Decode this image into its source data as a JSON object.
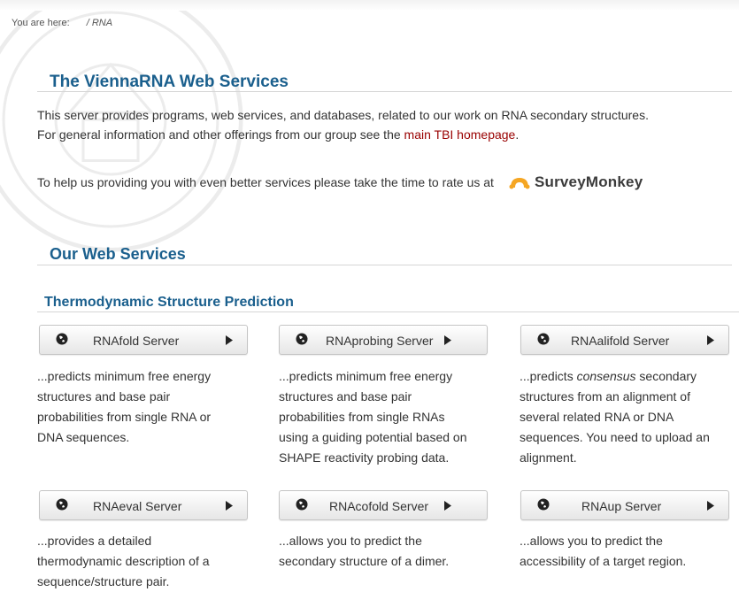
{
  "breadcrumb": {
    "prefix": "You are here:",
    "path": "/ RNA"
  },
  "header": {
    "title": "The ViennaRNA Web Services"
  },
  "intro": {
    "line1": "This server provides programs, web services, and databases, related to our work on RNA secondary structures.",
    "line2_before": "For general information and other offerings from our group see the ",
    "link_text": "main TBI homepage",
    "line2_after": "."
  },
  "survey": {
    "text": "To help us providing you with even better services please take the time to rate us at",
    "brand": "SurveyMonkey"
  },
  "section": {
    "title": "Our Web Services"
  },
  "subsection": {
    "title": "Thermodynamic Structure Prediction"
  },
  "services": [
    {
      "label": "RNAfold Server",
      "desc_lines": [
        "...predicts minimum free energy",
        "structures and base pair",
        "probabilities from single RNA or",
        "DNA sequences."
      ]
    },
    {
      "label": "RNAprobing Server",
      "desc_lines": [
        "...predicts minimum free energy",
        "structures and base pair",
        "probabilities from single RNAs",
        "using a guiding potential based on",
        "SHAPE reactivity probing data."
      ]
    },
    {
      "label": "RNAalifold Server",
      "desc_pre": "...predicts ",
      "desc_em": "consensus",
      "desc_post": " secondary",
      "desc_lines": [
        "structures from an alignment of",
        "several related RNA or DNA",
        "sequences. You need to upload an",
        "alignment."
      ]
    },
    {
      "label": "RNAeval Server",
      "desc_lines": [
        "...provides a detailed",
        "thermodynamic description of a",
        "sequence/structure pair."
      ]
    },
    {
      "label": "RNAcofold Server",
      "desc_lines": [
        "...allows you to predict the",
        "secondary structure of a dimer."
      ]
    },
    {
      "label": "RNAup Server",
      "desc_lines": [
        "...allows you to predict the",
        "accessibility of a target region."
      ]
    }
  ],
  "colors": {
    "heading": "#1a5f8d",
    "link": "#990000",
    "survey_logo": "#f5a623"
  }
}
